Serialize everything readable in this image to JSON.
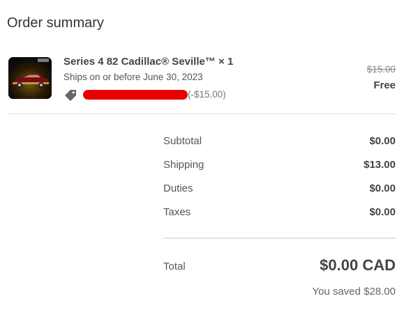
{
  "order_summary": {
    "title": "Order summary",
    "item": {
      "image_name": "cadillac-seville-product-image",
      "name": "Series 4 82 Cadillac® Seville™ × 1",
      "ships": "Ships on or before June 30, 2023",
      "discount_icon": "tag-icon",
      "discount_code": "[redacted]",
      "discount_amount": "(-$15.00)",
      "original_price": "$15.00",
      "price": "Free"
    },
    "rows": [
      {
        "label": "Subtotal",
        "value": "$0.00"
      },
      {
        "label": "Shipping",
        "value": "$13.00"
      },
      {
        "label": "Duties",
        "value": "$0.00"
      },
      {
        "label": "Taxes",
        "value": "$0.00"
      }
    ],
    "total": {
      "label": "Total",
      "value": "$0.00 CAD"
    },
    "savings": "You saved $28.00",
    "colors": {
      "redaction": "#e80000",
      "text": "#333333",
      "divider": "#dddddd"
    }
  }
}
